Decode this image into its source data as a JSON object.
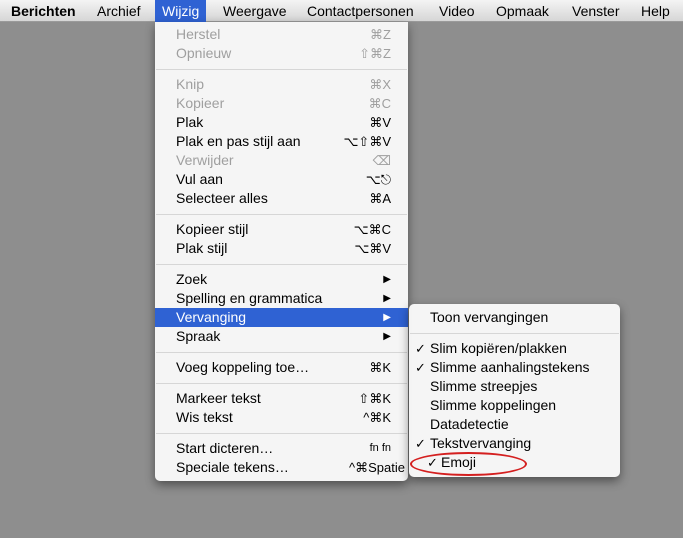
{
  "menubar": {
    "items": [
      "Berichten",
      "Archief",
      "Wijzig",
      "Weergave",
      "Contactpersonen",
      "Video",
      "Opmaak",
      "Venster",
      "Help"
    ],
    "active_index": 2
  },
  "wijzig_menu": {
    "herstel": {
      "label": "Herstel",
      "shortcut": "⌘Z"
    },
    "opnieuw": {
      "label": "Opnieuw",
      "shortcut": "⇧⌘Z"
    },
    "knip": {
      "label": "Knip",
      "shortcut": "⌘X"
    },
    "kopieer": {
      "label": "Kopieer",
      "shortcut": "⌘C"
    },
    "plak": {
      "label": "Plak",
      "shortcut": "⌘V"
    },
    "plak_stijl_aan": {
      "label": "Plak en pas stijl aan",
      "shortcut": "⌥⇧⌘V"
    },
    "verwijder": {
      "label": "Verwijder",
      "shortcut": "⌫"
    },
    "vul_aan": {
      "label": "Vul aan",
      "shortcut": "⌥⎋"
    },
    "selecteer_alles": {
      "label": "Selecteer alles",
      "shortcut": "⌘A"
    },
    "kopieer_stijl": {
      "label": "Kopieer stijl",
      "shortcut": "⌥⌘C"
    },
    "plak_stijl": {
      "label": "Plak stijl",
      "shortcut": "⌥⌘V"
    },
    "zoek": {
      "label": "Zoek",
      "arrow": "▶"
    },
    "spelling": {
      "label": "Spelling en grammatica",
      "arrow": "▶"
    },
    "vervanging": {
      "label": "Vervanging",
      "arrow": "▶"
    },
    "spraak": {
      "label": "Spraak",
      "arrow": "▶"
    },
    "koppeling": {
      "label": "Voeg koppeling toe…",
      "shortcut": "⌘K"
    },
    "markeer": {
      "label": "Markeer tekst",
      "shortcut": "⇧⌘K"
    },
    "wis": {
      "label": "Wis tekst",
      "shortcut": "^⌘K"
    },
    "dicteren": {
      "label": "Start dicteren…",
      "shortcut": "fn fn"
    },
    "speciale": {
      "label": "Speciale tekens…",
      "shortcut": "^⌘Spatie"
    }
  },
  "vervanging_submenu": {
    "toon": {
      "label": "Toon vervangingen"
    },
    "slim_kopieren": {
      "label": "Slim kopiëren/plakken",
      "check": "✓"
    },
    "aanhalingstekens": {
      "label": "Slimme aanhalingstekens",
      "check": "✓"
    },
    "streepjes": {
      "label": "Slimme streepjes"
    },
    "koppelingen": {
      "label": "Slimme koppelingen"
    },
    "datadetectie": {
      "label": "Datadetectie"
    },
    "tekstvervanging": {
      "label": "Tekstvervanging",
      "check": "✓"
    },
    "emoji": {
      "label": "Emoji",
      "check": "✓"
    }
  },
  "colors": {
    "highlight": "#2f62d3",
    "annotation": "#d41f1f",
    "desktop": "#8e8e8e"
  }
}
